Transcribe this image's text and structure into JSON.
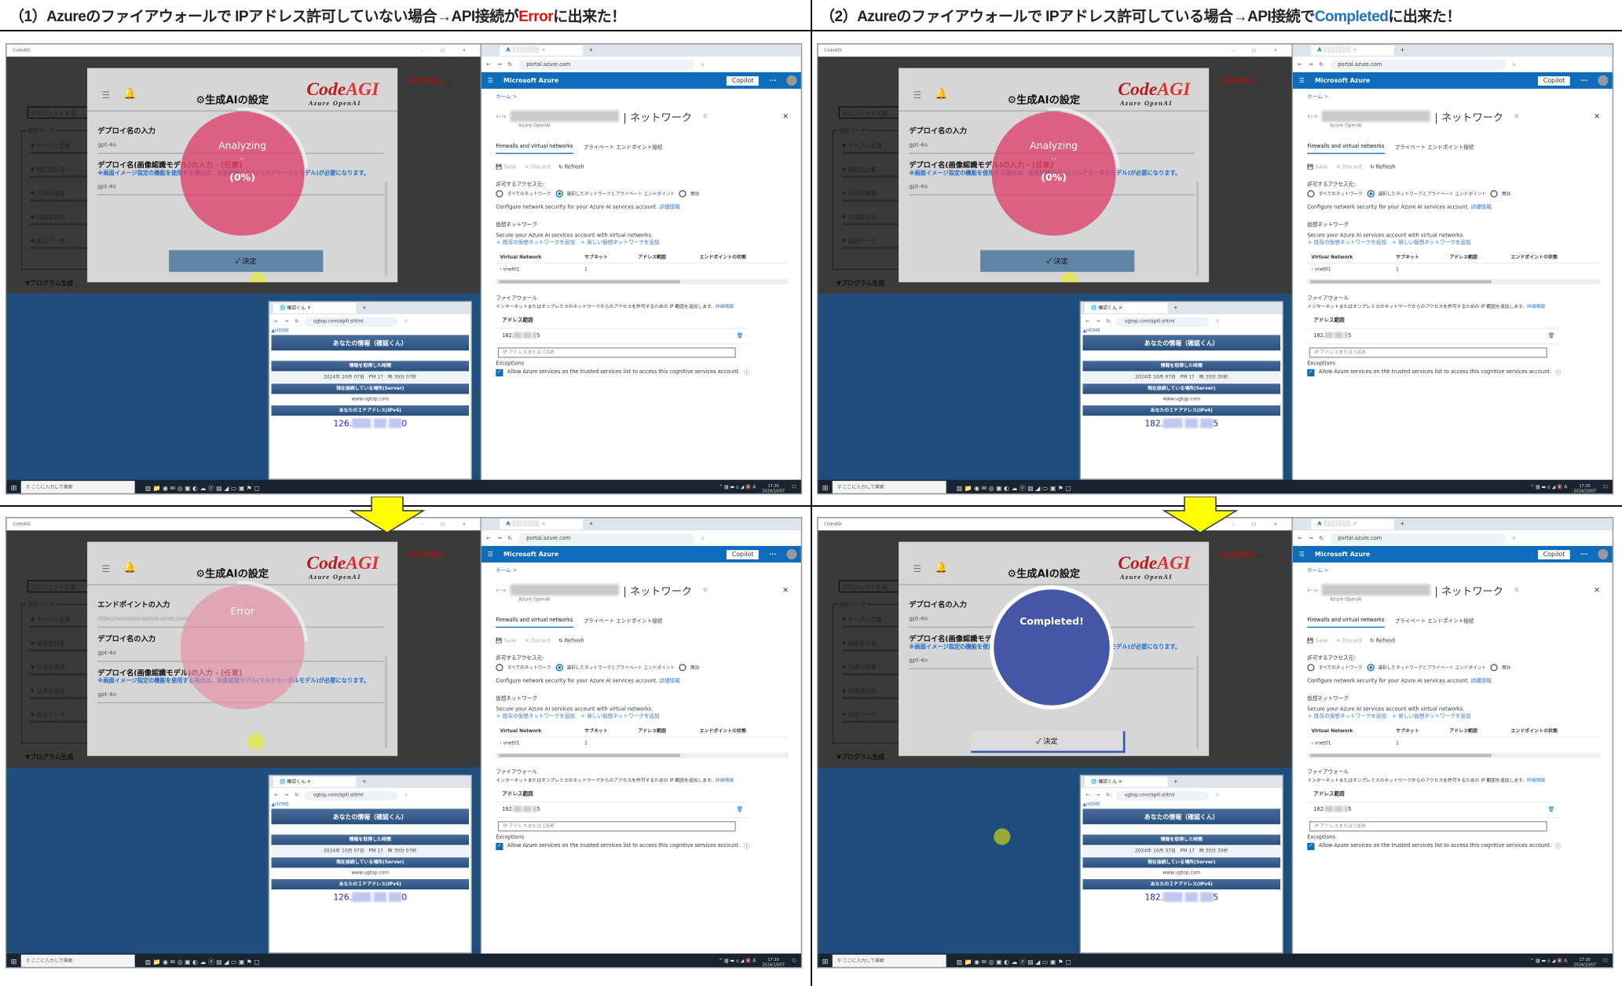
{
  "titles": {
    "left": {
      "prefix": "（1）Azureのファイアウォールで IPアドレス許可していない場合→API接続が",
      "highlight": "Error",
      "suffix": "に出来た！"
    },
    "right": {
      "prefix": "（2）Azureのファイアウォールで IPアドレス許可している場合→API接続で",
      "highlight": "Completed",
      "suffix": "に出来た！"
    }
  },
  "colors": {
    "error": "#e81010",
    "completed": "#1a73c8",
    "azure_blue": "#0f6cbd",
    "analyzing_circle": "#dc466e",
    "completed_circle": "#4656a6",
    "arrow": "#ffff00"
  },
  "codeagi": {
    "window_title": "CodeAGI",
    "window_controls": "–  □  ×",
    "project_select": "プロジェクトを選",
    "group_label": "解析データ",
    "sidebar_items": [
      "▼ テーブル定義",
      "▼ 機能設計書",
      "▼ 共通仕様書",
      "▼ 共通部品指",
      "▼ 指定データ"
    ],
    "program_gen": "▼プログラム生成",
    "soppra": "SOPPRA",
    "soppra_dx": "DX",
    "modal_title": "⚙生成AIの設定",
    "logo_code": "Code",
    "logo_agi": "AGI",
    "logo_sub": "Azure  OpenAI",
    "hamburger_icon": "☰",
    "bell_icon": "🔔",
    "confirm_button": "✓ 決定"
  },
  "panels": [
    {
      "fields": [
        {
          "label": "デプロイ名の入力",
          "value": "gpt-4o"
        },
        {
          "label": "デプロイ名(画像認識モデル)の入力 - ",
          "optional": "[任意]",
          "note": "※画面イメージ指定の機能を使用する場合は、画像認識モデル(マルチモーダルモデル)が必要になります。",
          "value": "gpt-4o"
        }
      ],
      "status": "Analyzing",
      "dots": "..",
      "progress": "(0%)",
      "state": "analyzing",
      "button_visible": true,
      "ugtop_time": "2024年 10月 07日　PM 17　時 30分 07秒",
      "ip_prefix": "126.",
      "ip_suffix": "0"
    },
    {
      "fields": [
        {
          "label": "デプロイ名の入力",
          "value": "gpt-4o"
        },
        {
          "label": "デプロイ名(画像認識モデル)の入力 - ",
          "optional": "[任意]",
          "note": "※画面イメージ指定の機能を使用する場合は、画像認識モデル(マルチモーダルモデル)が必要になります。",
          "value": "gpt-4o"
        }
      ],
      "status": "Analyzing",
      "dots": "..",
      "progress": "(0%)",
      "state": "analyzing",
      "button_visible": true,
      "ugtop_time": "2024年 10月 07日　PM 17　時 30分 30秒",
      "ip_prefix": "182.",
      "ip_suffix": "5"
    },
    {
      "fields": [
        {
          "label": "エンドポイントの入力",
          "value": "https://xxxxxxxx.openai.azure.com/",
          "blur": true
        },
        {
          "label": "デプロイ名の入力",
          "value": "gpt-4o"
        },
        {
          "label": "デプロイ名(画像認識モデル)の入力 - ",
          "optional": "[任意]",
          "note": "※画面イメージ指定の機能を使用する場合は、画像認識モデル(マルチモーダルモデル)が必要になります。",
          "value": "gpt-4o"
        }
      ],
      "status": "Error",
      "dots": "",
      "progress": "",
      "state": "error",
      "button_visible": false,
      "ugtop_time": "2024年 10月 07日　PM 17　時 30分 07秒",
      "ip_prefix": "126.",
      "ip_suffix": "0"
    },
    {
      "fields": [
        {
          "label": "デプロイ名の入力",
          "value": "gpt-4o"
        },
        {
          "label": "デプロイ名(画像認識モデル)の入力 - ",
          "optional": "[任意]",
          "note": "※画面イメージ指定の機能を使用する場合は、画像認識モデル(マルチモーダルモデル)が必要になります。",
          "value": "gpt-4o"
        }
      ],
      "status": "Completed!",
      "dots": "",
      "progress": "",
      "state": "completed",
      "button_visible": true,
      "ugtop_time": "2024年 10月 07日　PM 17　時 30分 30秒",
      "ip_prefix": "182.",
      "ip_suffix": "5"
    }
  ],
  "ugtop": {
    "tab_title": "確認くん",
    "url": "ugtop.com/spill.shtml",
    "home_link": "▲HOME",
    "header": "あなたの情報（確認くん）",
    "time_label": "情報を取得した時間",
    "server_label": "現在接続している場所(Server)",
    "server_value": "www.ugtop.com",
    "ip_label": "あなたのＩＰアドレス(IPv4)"
  },
  "azure": {
    "url": "portal.azure.com",
    "brand": "Microsoft Azure",
    "copilot": "Copilot",
    "more": "···",
    "breadcrumb_home": "ホーム >",
    "resource_title": "| ネットワーク",
    "resource_type": "Azure OpenAI",
    "tabs": [
      "Firewalls and virtual networks",
      "プライベート エンドポイント接続"
    ],
    "toolbar": {
      "save": "💾 Save",
      "discard": "✕ Discard",
      "refresh": "↻ Refresh"
    },
    "access_label": "許可するアクセス元:",
    "access_options": [
      "すべてのネットワーク",
      "選択したネットワークとプライベート エンドポイント",
      "無効"
    ],
    "access_selected": 1,
    "configure_text": "Configure network security for your Azure AI services account.",
    "more_info": "詳細情報",
    "vnet_heading": "仮想ネットワーク",
    "vnet_text": "Secure your Azure AI services account with virtual networks.",
    "add_existing": "＋ 既存の仮想ネットワークを追加",
    "add_new": "＋ 新しい仮想ネットワークを追加",
    "vnet_columns": [
      "Virtual Network",
      "サブネット",
      "アドレス範囲",
      "エンドポイントの状態"
    ],
    "vnet_rows": [
      [
        "› vnet01",
        "1",
        "",
        ""
      ]
    ],
    "firewall_heading": "ファイアウォール",
    "firewall_text": "インターネットまたはオンプレミスのネットワークからのアクセスを許可するための IP 範囲を追加します。",
    "address_range_label": "アドレス範囲",
    "ip_prefix": "182.",
    "ip_suffix": "5",
    "ip_placeholder": "IP アドレスまたは CIDR",
    "exceptions_label": "Exceptions",
    "exception_text": "Allow Azure services on the trusted services list to access this cognitive services account.",
    "exception_checked": true
  },
  "taskbar": {
    "search_placeholder": "ここに入力して検索",
    "time": "17:30",
    "date": "2024/10/07"
  }
}
